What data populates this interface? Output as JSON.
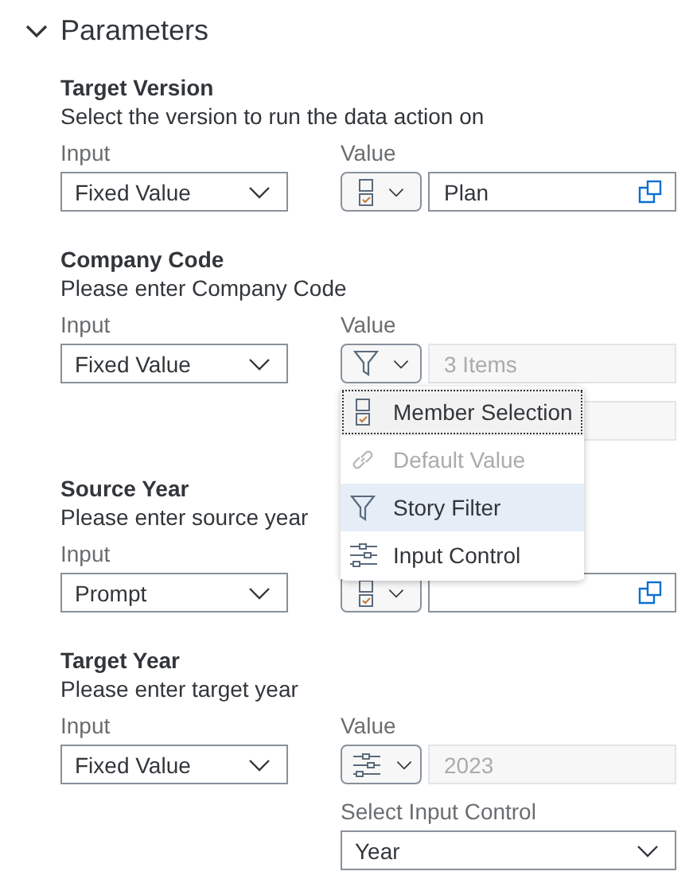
{
  "panel": {
    "title": "Parameters",
    "expanded": true
  },
  "parameters": [
    {
      "title": "Target Version",
      "description": "Select the version to run the data action on",
      "input": {
        "label": "Input",
        "value": "Fixed Value"
      },
      "value": {
        "label": "Value",
        "kind": "member",
        "text": "Plan",
        "disabled": false,
        "picker": true
      }
    },
    {
      "title": "Company Code",
      "description": "Please enter Company Code",
      "input": {
        "label": "Input",
        "value": "Fixed Value"
      },
      "value": {
        "label": "Value",
        "kind": "filter",
        "text": "3 Items",
        "disabled": true,
        "picker": false
      },
      "extra_field": {
        "disabled": true
      },
      "menu": [
        {
          "kind": "member",
          "label": "Member Selection",
          "disabled": false,
          "selected": false,
          "focused": true
        },
        {
          "kind": "link",
          "label": "Default Value",
          "disabled": true,
          "selected": false,
          "focused": false
        },
        {
          "kind": "filter",
          "label": "Story Filter",
          "disabled": false,
          "selected": true,
          "focused": false
        },
        {
          "kind": "control",
          "label": "Input Control",
          "disabled": false,
          "selected": false,
          "focused": false
        }
      ]
    },
    {
      "title": "Source Year",
      "description": "Please enter source year",
      "input": {
        "label": "Input",
        "value": "Prompt"
      },
      "value": {
        "kind": "member",
        "disabled": false,
        "picker": true
      }
    },
    {
      "title": "Target Year",
      "description": "Please enter target year",
      "input": {
        "label": "Input",
        "value": "Fixed Value"
      },
      "value": {
        "label": "Value",
        "kind": "control",
        "text": "2023",
        "disabled": true,
        "picker": false
      },
      "input_control": {
        "label": "Select Input Control",
        "value": "Year"
      }
    }
  ]
}
